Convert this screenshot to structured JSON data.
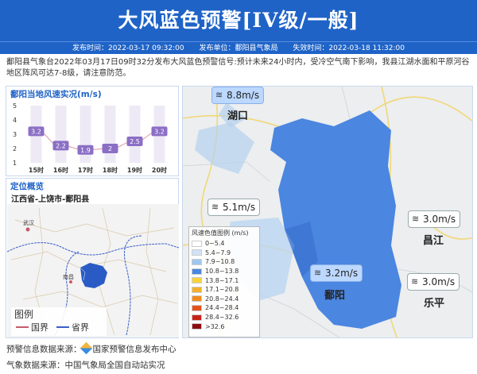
{
  "banner": {
    "title": "大风蓝色预警[IV级/一般]",
    "publish_label": "发布时间：",
    "publish_time": "2022-03-17 09:32:00",
    "unit_label": "发布单位：",
    "unit": "鄱阳县气象局",
    "expire_label": "失效时间：",
    "expire_time": "2022-03-18 11:32:00"
  },
  "body_text": "鄱阳县气象台2022年03月17日09时32分发布大风蓝色预警信号:预计未来24小时内，受冷空气南下影响，我县江湖水面和平原河谷地区阵风可达7-8级，请注意防范。",
  "wind_panel": {
    "title": "鄱阳当地风速实况(m/s)",
    "chart_data": {
      "type": "line",
      "title": "鄱阳当地风速实况(m/s)",
      "categories": [
        "15时",
        "16时",
        "17时",
        "18时",
        "19时",
        "20时"
      ],
      "values": [
        3.2,
        2.2,
        1.9,
        2,
        2.5,
        3.2
      ],
      "labels": [
        "3.2",
        "2.2",
        "1.9",
        "2",
        "2.5",
        "3.2"
      ],
      "y_ticks": [
        "1",
        "2",
        "3",
        "4",
        "5"
      ],
      "ylim": [
        1,
        5
      ],
      "color": "#8b6fc5",
      "curve_color": "#e0a7b2"
    }
  },
  "location_panel": {
    "title": "定位概览",
    "subtitle": "江西省-上饶市-鄱阳县",
    "legend_title": "图例",
    "legend_items": [
      {
        "label": "国界",
        "color": "#c65b6b"
      },
      {
        "label": "省界",
        "color": "#3b5fc8"
      }
    ],
    "city_labels": [
      "武汉",
      "南昌"
    ],
    "region_color": "#2a5bc4"
  },
  "map_panel": {
    "legend_title": "风速色值图例 (m/s)",
    "legend": [
      {
        "label": "0~5.4",
        "color": "#ffffff"
      },
      {
        "label": "5.4~7.9",
        "color": "#cfe3f7"
      },
      {
        "label": "7.9~10.8",
        "color": "#9ec7f0"
      },
      {
        "label": "10.8~13.8",
        "color": "#4b86e0"
      },
      {
        "label": "13.8~17.1",
        "color": "#f7d43c"
      },
      {
        "label": "17.1~20.8",
        "color": "#f5b12c"
      },
      {
        "label": "20.8~24.4",
        "color": "#f08a1f"
      },
      {
        "label": "24.4~28.4",
        "color": "#e4511c"
      },
      {
        "label": "28.4~32.6",
        "color": "#c7221a"
      },
      {
        "label": ">32.6",
        "color": "#8b0e0e"
      }
    ],
    "stations": [
      {
        "speed": "8.8m/s",
        "place": "湖口"
      },
      {
        "speed": "5.1m/s",
        "place": ""
      },
      {
        "speed": "3.0m/s",
        "place": "昌江"
      },
      {
        "speed": "3.2m/s",
        "place": "鄱阳"
      },
      {
        "speed": "3.0m/s",
        "place": "乐平"
      }
    ],
    "region_color": "#4b86e0"
  },
  "footer": {
    "warning_source_label": "预警信息数据来源：",
    "warning_source": "国家预警信息发布中心",
    "weather_source_label": "气象数据来源：",
    "weather_source": "中国气象局全国自动站实况"
  }
}
